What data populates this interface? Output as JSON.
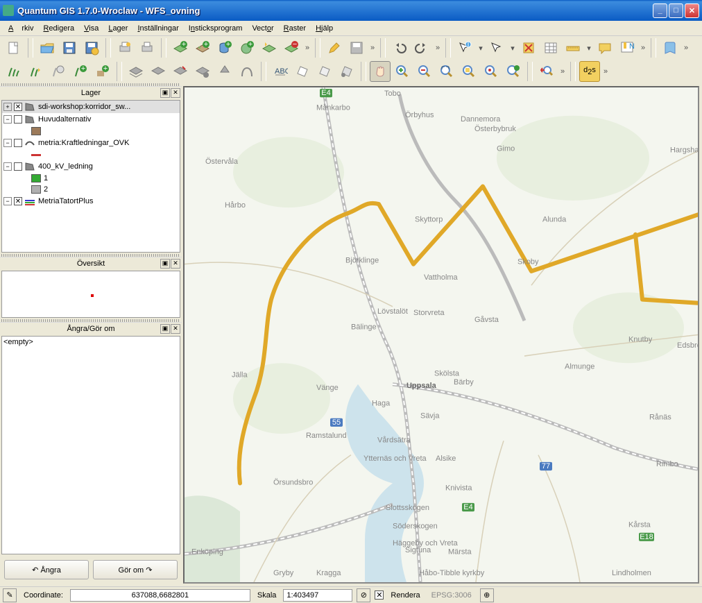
{
  "window": {
    "title": "Quantum GIS 1.7.0-Wroclaw - WFS_ovning"
  },
  "menu": {
    "arkiv": "Arkiv",
    "redigera": "Redigera",
    "visa": "Visa",
    "lager": "Lager",
    "installningar": "Inställningar",
    "insticks": "Insticksprogram",
    "vector": "Vector",
    "raster": "Raster",
    "hjalp": "Hjälp"
  },
  "panels": {
    "lager": "Lager",
    "oversikt": "Översikt",
    "angra": "Ångra/Gör om",
    "empty": "<empty>"
  },
  "layers": [
    {
      "name": "sdi-workshop:korridor_sw...",
      "checked": true,
      "selected": true,
      "sym": "poly"
    },
    {
      "name": "Huvudalternativ",
      "checked": false,
      "sym": "poly",
      "children": [
        {
          "color": "#9c7a5a",
          "label": ""
        }
      ]
    },
    {
      "name": "metria:Kraftledningar_OVK",
      "checked": false,
      "sym": "line",
      "children": [
        {
          "color": "#cc3333",
          "label": "",
          "line": true
        }
      ]
    },
    {
      "name": "400_kV_ledning",
      "checked": false,
      "sym": "poly",
      "children": [
        {
          "color": "#33aa33",
          "label": "1"
        },
        {
          "color": "#b0b0b0",
          "label": "2"
        }
      ]
    },
    {
      "name": "MetriaTatortPlus",
      "checked": true,
      "sym": "raster"
    }
  ],
  "buttons": {
    "angra": "Ångra",
    "gorom": "Gör om"
  },
  "status": {
    "coord_label": "Coordinate:",
    "coord": "637088,6682801",
    "skala_label": "Skala",
    "skala": "1:403497",
    "rendera": "Rendera",
    "epsg": "EPSG:3006"
  },
  "map": {
    "places": [
      "Tobo",
      "Månkarbo",
      "Örbyhus",
      "Dannemora",
      "Österbybruk",
      "Gimo",
      "Hargshamn",
      "Östervåla",
      "Hårbo",
      "Björklinge",
      "Skyttorp",
      "Alunda",
      "Skoby",
      "Vattholma",
      "Lövstalöt",
      "Storvreta",
      "Bälinge",
      "Gåvsta",
      "Knutby",
      "Edsbro",
      "Jälla",
      "Vänge",
      "Skölsta",
      "Bärby",
      "Almunge",
      "Uppsala",
      "Haga",
      "Sävja",
      "Rånäs",
      "Ramstalund",
      "Vårdsätra",
      "Ytternäs och Vreta",
      "Alsike",
      "Rimbo",
      "Örsundsbro",
      "Knivista",
      "Slottsskogen",
      "Söderskogen",
      "Häggeby och Vreta",
      "Kårsta",
      "Enköping",
      "Gryby",
      "Kragga",
      "Sigtuna",
      "Märsta",
      "Håbo-Tibble kyrkby",
      "Lindholmen"
    ],
    "roads": [
      "E4",
      "55",
      "77",
      "E18",
      "E18"
    ]
  }
}
